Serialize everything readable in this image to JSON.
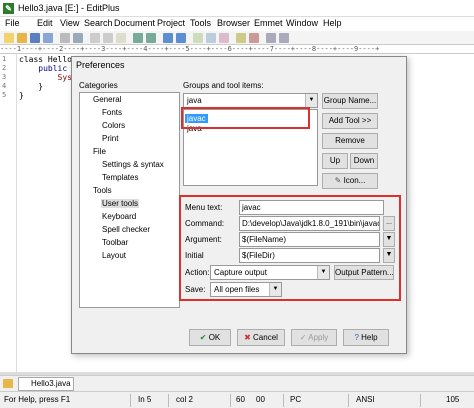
{
  "window": {
    "title": "Hello3.java [E:] - EditPlus"
  },
  "menu": [
    "File",
    "Edit",
    "View",
    "Search",
    "Document",
    "Project",
    "Tools",
    "Browser",
    "Emmet",
    "Window",
    "Help"
  ],
  "ruler": "----1----+----2----+----3----+----4----+----5----+----6----+----7----+----8----+----9----+",
  "editor": {
    "line_numbers": [
      "1",
      "2",
      "3",
      "4",
      "5"
    ],
    "lines": [
      "class Hello3",
      "    public st",
      "        Syste",
      "    }",
      "}"
    ]
  },
  "dialog": {
    "title": "Preferences",
    "categories_label": "Categories",
    "categories": [
      "General",
      "Fonts",
      "Colors",
      "Print",
      "File",
      "Settings & syntax",
      "Templates",
      "Tools",
      "User tools",
      "Keyboard",
      "Spell checker",
      "Toolbar",
      "Layout"
    ],
    "groups_label": "Groups and tool items:",
    "group_value": "java",
    "tool_items": [
      "javac",
      "java"
    ],
    "buttons": {
      "group_name": "Group Name...",
      "add_tool": "Add Tool >>",
      "remove": "Remove",
      "up": "Up",
      "down": "Down",
      "icon": "Icon...",
      "ok": "OK",
      "cancel": "Cancel",
      "apply": "Apply",
      "help": "Help",
      "output_pattern": "Output Pattern..."
    },
    "fields": {
      "menu_text_label": "Menu text:",
      "menu_text": "javac",
      "command_label": "Command:",
      "command": "D:\\develop\\Java\\jdk1.8.0_191\\bin\\javac.e",
      "argument_label": "Argument:",
      "argument": "$(FileName)",
      "initial_label": "Initial",
      "initial": "$(FileDir)",
      "action_label": "Action:",
      "action": "Capture output",
      "save_label": "Save:",
      "save": "All open files"
    }
  },
  "tabs": {
    "doc_tab": "Hello3.java"
  },
  "status": {
    "help": "For Help, press F1",
    "ln": "In 5",
    "col": "col 2",
    "num1": "60",
    "num2": "00",
    "pc": "PC",
    "enc": "ANSI",
    "num3": "105"
  }
}
